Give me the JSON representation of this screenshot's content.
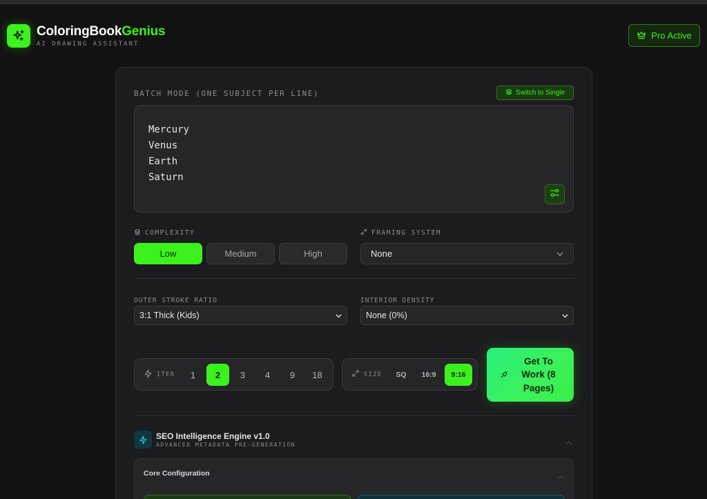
{
  "brand": {
    "title_part1": "ColoringBook",
    "title_part2": "Genius",
    "subtitle": "AI DRAWING ASSISTANT",
    "accent": "#3cf21e"
  },
  "pro_badge": {
    "label": "Pro Active",
    "icon": "crown-icon"
  },
  "batch": {
    "label": "BATCH MODE (ONE SUBJECT PER LINE)",
    "switch_label": "Switch to Single",
    "lines": [
      "Mercury",
      "Venus",
      "Earth",
      "Saturn"
    ]
  },
  "complexity": {
    "label": "COMPLEXITY",
    "options": [
      "Low",
      "Medium",
      "High"
    ],
    "selected": "Low"
  },
  "framing": {
    "label": "FRAMING SYSTEM",
    "value": "None"
  },
  "outer_stroke": {
    "label": "OUTER STROKE RATIO",
    "value": "3:1 Thick (Kids)"
  },
  "interior_density": {
    "label": "INTERIOR DENSITY",
    "value": "None (0%)"
  },
  "iterations": {
    "label": "ITER",
    "options": [
      "1",
      "2",
      "3",
      "4",
      "9",
      "18"
    ],
    "selected": "2"
  },
  "size": {
    "label": "SIZE",
    "options": [
      "SQ",
      "16:9",
      "9:16"
    ],
    "selected": "9:16"
  },
  "go_button": {
    "label": "Get To Work (8 Pages)"
  },
  "seo": {
    "title": "SEO Intelligence Engine v1.0",
    "subtitle": "ADVANCED METADATA PRE-GENERATION"
  },
  "core_config": {
    "title": "Core Configuration"
  }
}
